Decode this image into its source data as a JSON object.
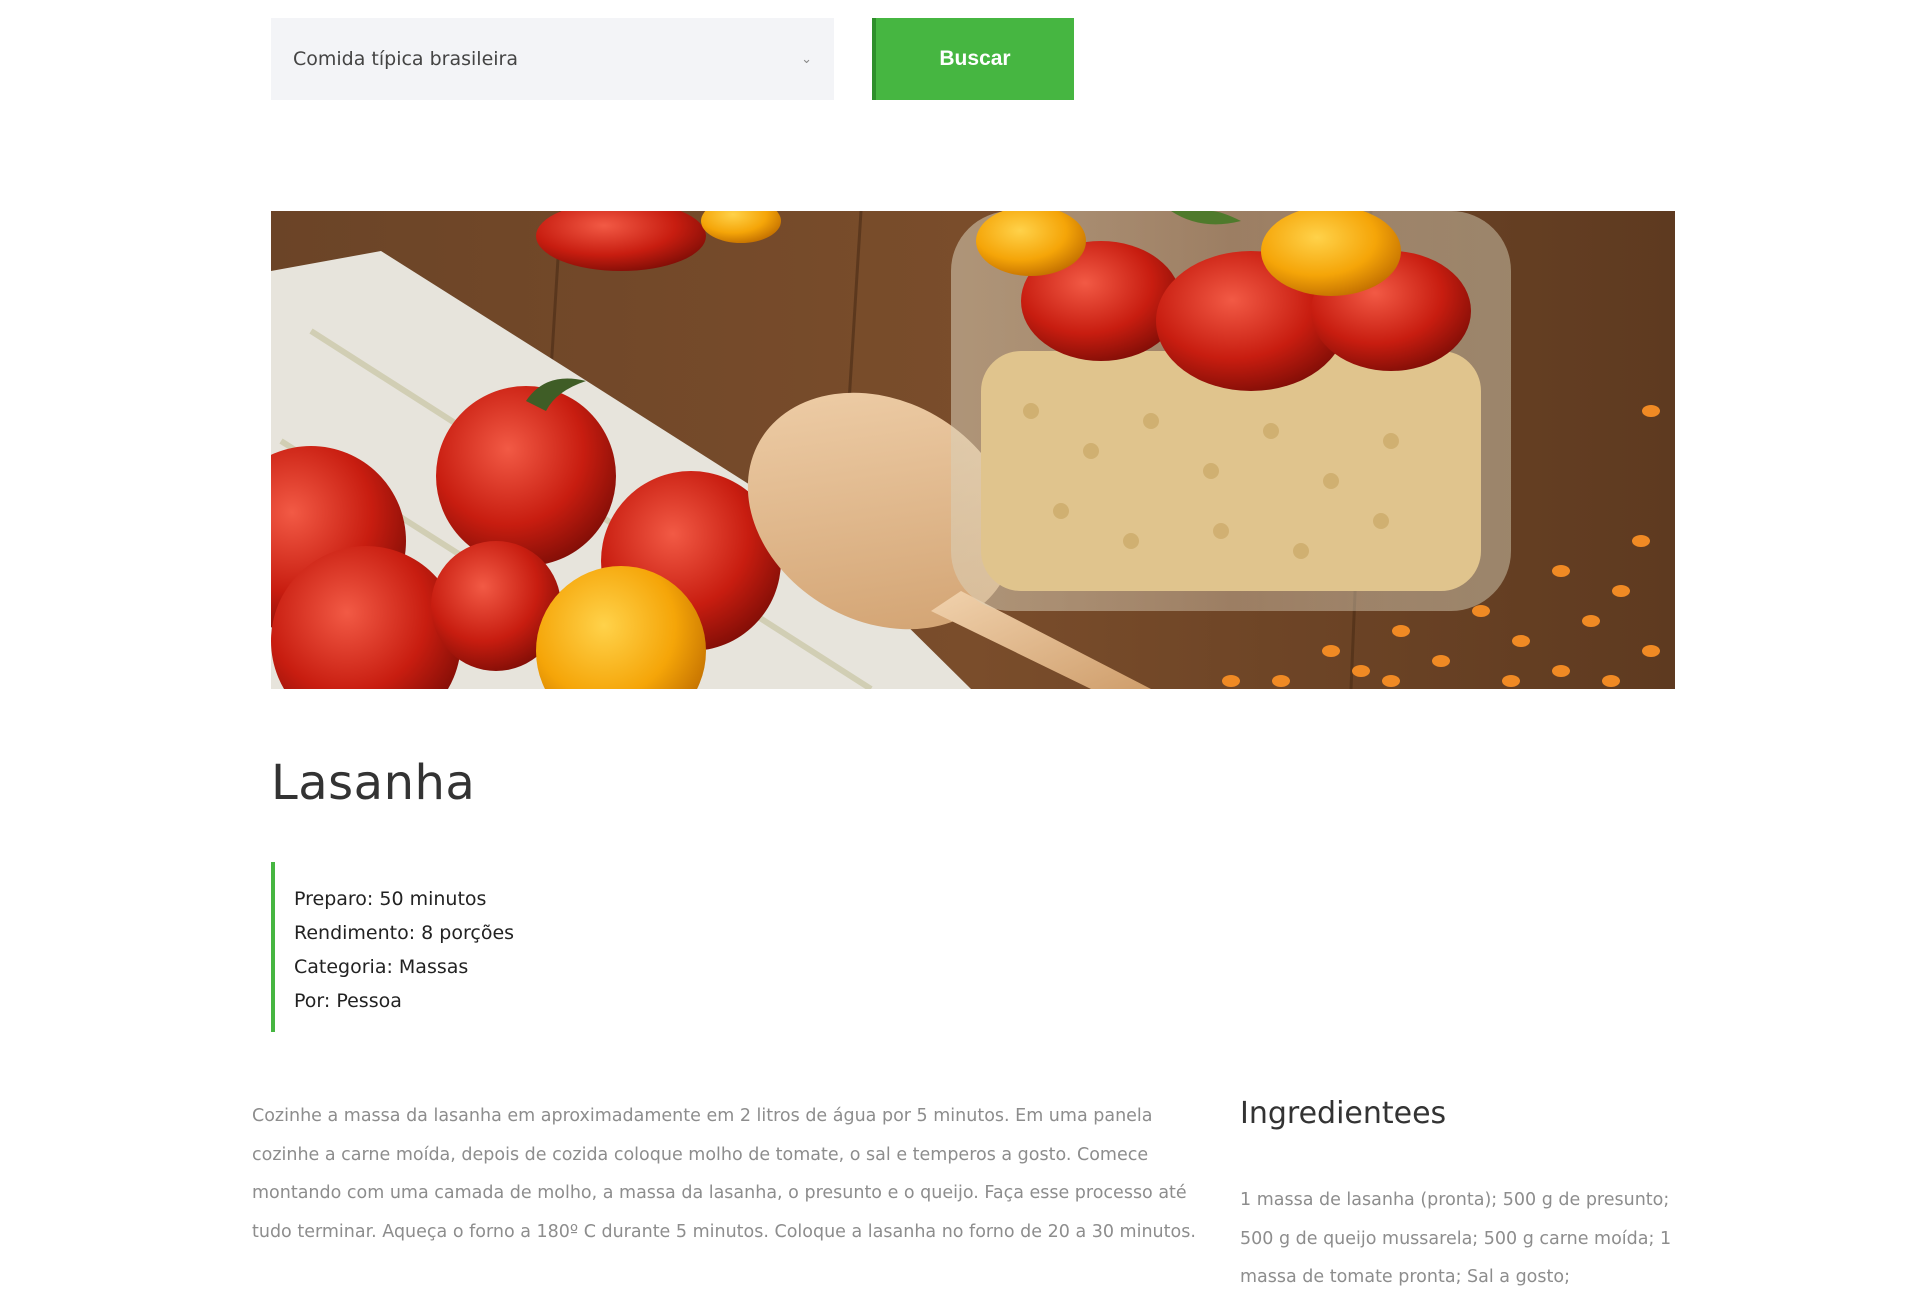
{
  "search": {
    "selected_option": "Comida típica brasileira",
    "button_label": "Buscar"
  },
  "colors": {
    "accent": "#46b641",
    "select_background": "#f3f4f7",
    "muted_text": "#8d8d8d"
  },
  "icons": {
    "select_arrow": "chevron-down-icon"
  },
  "recipe": {
    "title": "Lasanha",
    "meta": {
      "preparo": "Preparo: 50 minutos",
      "rendimento": "Rendimento: 8 porções",
      "categoria": "Categoria: Massas",
      "por": "Por: Pessoa"
    },
    "instructions": "Cozinhe a massa da lasanha em aproximadamente em 2 litros de água por 5 minutos. Em uma panela cozinhe a carne moída, depois de cozida coloque molho de tomate, o sal e temperos a gosto. Comece montando com uma camada de molho, a massa da lasanha, o presunto e o queijo. Faça esse processo até tudo terminar. Aqueça o forno a 180º C durante 5 minutos. Coloque a lasanha no forno de 20 a 30 minutos.",
    "ingredients_title": "Ingredientees",
    "ingredients": "1 massa de lasanha (pronta); 500 g de presunto; 500 g de queijo mussarela; 500 g carne moída; 1 massa de tomate pronta; Sal a gosto;"
  }
}
